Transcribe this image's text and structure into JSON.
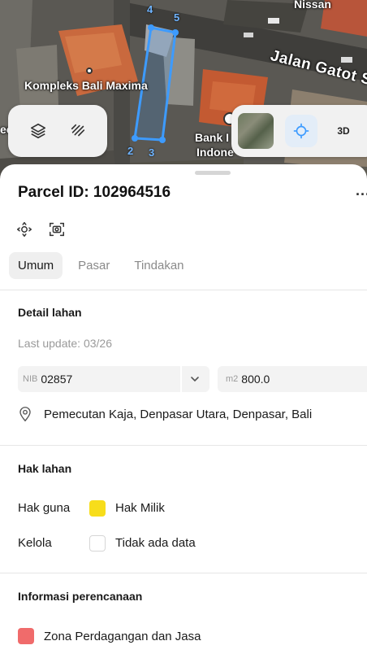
{
  "map": {
    "labels": {
      "nissan": "Nissan",
      "jalan": "Jalan Gatot S",
      "kompleks": "Kompleks Bali Maxima",
      "bank": "Bank I",
      "indone": "Indone",
      "edge": "ee"
    },
    "vertex_labels": [
      "4",
      "5",
      "2",
      "3"
    ],
    "parcel_color": "#3d9bff",
    "controls": {
      "layers_icon": "layers-icon",
      "draw_icon": "draw-icon",
      "satellite_icon": "satellite-thumbnail",
      "locate_icon": "crosshair-icon",
      "mode_3d": "3D"
    }
  },
  "sheet": {
    "title": "Parcel ID: 102964516",
    "more": "...",
    "tools": [
      "recenter-icon",
      "screenshot-icon"
    ],
    "tabs": [
      {
        "label": "Umum",
        "active": true
      },
      {
        "label": "Pasar",
        "active": false
      },
      {
        "label": "Tindakan",
        "active": false
      }
    ],
    "detail": {
      "title": "Detail lahan",
      "last_update": "Last update: 03/26",
      "nib_prefix": "NIB",
      "nib_value": "02857",
      "area_prefix": "m2",
      "area_value": "800.0",
      "address": "Pemecutan Kaja, Denpasar Utara, Denpasar, Bali"
    },
    "hak": {
      "title": "Hak lahan",
      "rows": [
        {
          "label": "Hak guna",
          "value": "Hak Milik",
          "color": "#f7dd1b"
        },
        {
          "label": "Kelola",
          "value": "Tidak ada data",
          "color": "#ffffff"
        }
      ]
    },
    "perencanaan": {
      "title": "Informasi perencanaan",
      "zona": "Zona Perdagangan dan Jasa",
      "zona_color": "#f06b6b"
    }
  }
}
